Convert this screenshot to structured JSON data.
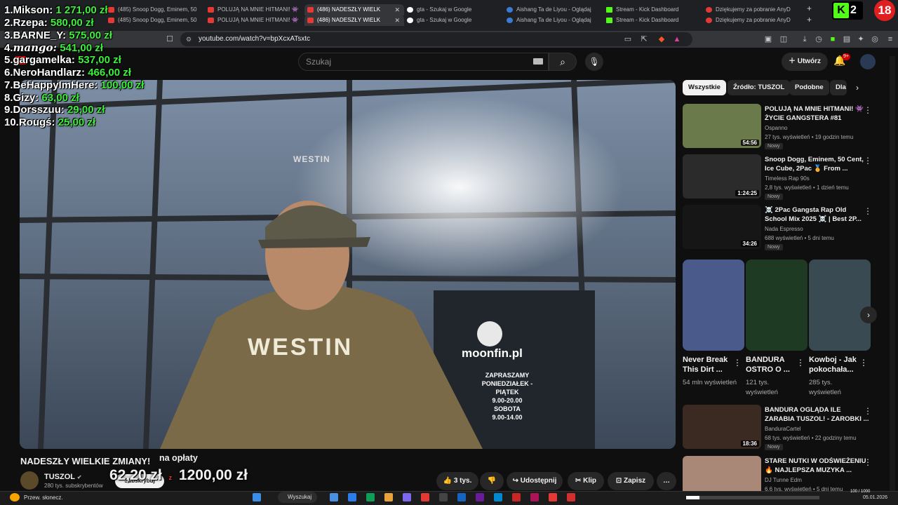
{
  "tabs_row1": [
    {
      "label": "(485) Snoop Dogg, Eminem, 50",
      "icon": "youtube-icon"
    },
    {
      "label": "POLUJĄ NA MNIE HITMANI! 👾",
      "icon": "youtube-icon"
    },
    {
      "label": "(486) NADESZŁY WIELK",
      "icon": "youtube-icon",
      "active": true
    },
    {
      "label": "gta - Szukaj w Google",
      "icon": "google-icon"
    },
    {
      "label": "Aishang Ta de Liyou - Oglądaj",
      "icon": "aishang-icon"
    },
    {
      "label": "Stream - Kick Dashboard",
      "icon": "kick-icon"
    },
    {
      "label": "Dziękujemy za pobranie AnyD",
      "icon": "anydesk-icon"
    }
  ],
  "tabs_row2": [
    {
      "label": "(485) Snoop Dogg, Eminem, 50",
      "icon": "youtube-icon"
    },
    {
      "label": "POLUJĄ NA MNIE HITMANI! 👾",
      "icon": "youtube-icon"
    },
    {
      "label": "(486) NADESZŁY WIELK",
      "icon": "youtube-icon",
      "active": true
    },
    {
      "label": "gta - Szukaj w Google",
      "icon": "google-icon"
    },
    {
      "label": "Aishang Ta de Liyou - Oglądaj",
      "icon": "aishang-icon"
    },
    {
      "label": "Stream - Kick Dashboard",
      "icon": "kick-icon"
    },
    {
      "label": "Dziękujemy za pobranie AnyD",
      "icon": "anydesk-icon"
    }
  ],
  "new_tab": "+",
  "address": {
    "url": "youtube.com/watch?v=bpXcxATsxtc"
  },
  "leaderboard": [
    {
      "rank": "1.",
      "name": "Mikson:",
      "amount": "1 271,00 zł"
    },
    {
      "rank": "2.",
      "name": "Rzepa:",
      "amount": "580,00 zł"
    },
    {
      "rank": "3.",
      "name": "BARNE_Y:",
      "amount": "575,00 zł"
    },
    {
      "rank": "4.",
      "name": "mango:",
      "amount": "541,00 zł"
    },
    {
      "rank": "5.",
      "name": "gargamelka:",
      "amount": "537,00 zł"
    },
    {
      "rank": "6.",
      "name": "NeroHandlarz:",
      "amount": "466,00 zł"
    },
    {
      "rank": "7.",
      "name": "BeHappyImHere:",
      "amount": "100,00 zł"
    },
    {
      "rank": "8.",
      "name": "Gizy:",
      "amount": "63,00 zł"
    },
    {
      "rank": "9.",
      "name": "Dorsszuu:",
      "amount": "29,00 zł"
    },
    {
      "rank": "10.",
      "name": "Rougś:",
      "amount": "25,00 zł"
    }
  ],
  "kick_badge": {
    "k": "K",
    "count": "2"
  },
  "age_badge": "18",
  "yt": {
    "search_placeholder": "Szukaj",
    "create_label": "Utwórz",
    "bell_badge": "9+"
  },
  "video": {
    "storefront_text": "moonfin.pl",
    "hoodie_text": "WESTIN",
    "cap_text": "WESTIN",
    "door_sign": [
      "ZAPRASZAMY",
      "PONIEDZIAŁEK - PIĄTEK",
      "9.00-20.00",
      "SOBOTA",
      "9.00-14.00"
    ]
  },
  "info": {
    "title": "NADESZŁY WIELKIE ZMIANY!",
    "fee_label": "na opłaty",
    "channel": "TUSZOL",
    "subscribers": "280 tys. subskrybentów",
    "subscribe_label": "Subskrybuj",
    "donation_current": "62,20 zł",
    "donation_goal": "1200,00 zł",
    "likes": "3 tys.",
    "share": "Udostępnij",
    "clip": "Klip",
    "save": "Zapisz",
    "more": "…"
  },
  "chips": [
    "Wszystkie",
    "Źródło: TUSZOL",
    "Podobne",
    "Dla"
  ],
  "recommended": [
    {
      "title": "POLUJĄ NA MNIE HITMANI! 👾 ŻYCIE GANGSTERA #81",
      "channel": "Ospanno",
      "meta": "27 tys. wyświetleń • 19 godzin temu",
      "badge": "Nowy",
      "duration": "54:56",
      "thumb_color": "#6a7a4a"
    },
    {
      "title": "Snoop Dogg, Eminem, 50 Cent, Ice Cube, 2Pac 🏅 From ...",
      "channel": "Timeless Rap 90s",
      "meta": "2,8 tys. wyświetleń • 1 dzień temu",
      "badge": "Nowy",
      "duration": "1:24:25",
      "thumb_color": "#2b2b2b"
    },
    {
      "title": "☠️ 2Pac Gangsta Rap Old School Mix 2025 ☠️ | Best 2P...",
      "channel": "Nada Espresso",
      "meta": "688 wyświetleń • 5 dni temu",
      "badge": "Nowy",
      "duration": "34:26",
      "thumb_color": "#161616"
    }
  ],
  "shorts": [
    {
      "title": "Never Break This Dirt ...",
      "views": "54 mln wyświetleń",
      "color": "#4a5a8a"
    },
    {
      "title": "BANDURA OSTRO O ...",
      "views": "121 tys. wyświetleń",
      "color": "#1e3a22"
    },
    {
      "title": "Kowboj - Jak pokochała...",
      "views": "285 tys. wyświetleń",
      "color": "#3a4a52"
    }
  ],
  "recommended2": [
    {
      "title": "BANDURA OGLĄDA ILE ZARABIA TUSZOL! - ZAROBKI ...",
      "channel": "BanduraCartel",
      "meta": "68 tys. wyświetleń • 22 godziny temu",
      "badge": "Nowy",
      "duration": "18:36",
      "thumb_color": "#3a2a22"
    },
    {
      "title": "STARE NUTKI W ODŚWIEŻENIU 🔥 NAJLEPSZA MUZYKA ...",
      "channel": "DJ Tunne Edm",
      "meta": "6,6 tys. wyświetleń • 5 dni temu",
      "badge": "",
      "duration": "",
      "thumb_color": "#aa8877"
    }
  ],
  "taskbar": {
    "weather": "Przew. słonecz.",
    "search": "Wyszukaj",
    "progress_text": "100 / 1000",
    "progress_fraction": 0.1,
    "date": "05.01.2026"
  },
  "colors": {
    "accent_green": "#3cf03c",
    "kick_green": "#53fc18",
    "youtube_red": "#ff0000"
  }
}
